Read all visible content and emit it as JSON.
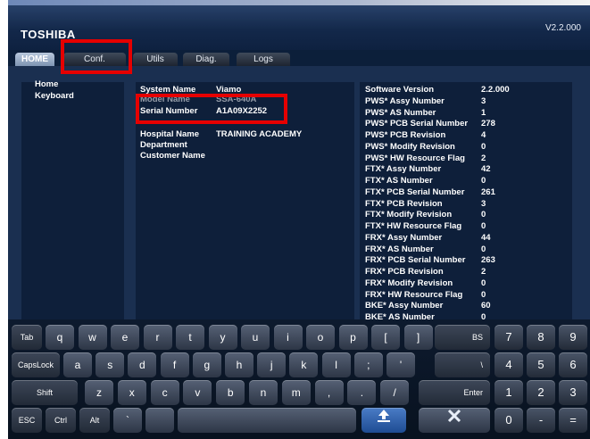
{
  "header": {
    "brand": "TOSHIBA",
    "version": "V2.2.000"
  },
  "tabs": [
    {
      "label": "HOME"
    },
    {
      "label": "Conf."
    },
    {
      "label": "Utils"
    },
    {
      "label": "Diag."
    },
    {
      "label": "Logs"
    }
  ],
  "sidebar": {
    "items": [
      {
        "label": "Home"
      },
      {
        "label": "Keyboard"
      }
    ]
  },
  "system_info": {
    "system_name": {
      "label": "System Name",
      "value": "Viamo"
    },
    "model_name": {
      "label": "Model Name",
      "value": "SSA-640A"
    },
    "serial_number": {
      "label": "Serial Number",
      "value": "A1A09X2252"
    },
    "hospital_name": {
      "label": "Hospital Name",
      "value": "TRAINING ACADEMY"
    },
    "department": {
      "label": "Department",
      "value": ""
    },
    "customer_name": {
      "label": "Customer Name",
      "value": ""
    }
  },
  "versions": [
    {
      "label": "Software Version",
      "value": "2.2.000"
    },
    {
      "label": "PWS* Assy Number",
      "value": "3"
    },
    {
      "label": "PWS* AS Number",
      "value": "1"
    },
    {
      "label": "PWS* PCB Serial Number",
      "value": "278"
    },
    {
      "label": "PWS* PCB Revision",
      "value": "4"
    },
    {
      "label": "PWS* Modify Revision",
      "value": "0"
    },
    {
      "label": "PWS* HW Resource Flag",
      "value": "2"
    },
    {
      "label": "FTX* Assy Number",
      "value": "42"
    },
    {
      "label": "FTX* AS Number",
      "value": "0"
    },
    {
      "label": "FTX* PCB Serial Number",
      "value": "261"
    },
    {
      "label": "FTX* PCB Revision",
      "value": "3"
    },
    {
      "label": "FTX* Modify Revision",
      "value": "0"
    },
    {
      "label": "FTX* HW Resource Flag",
      "value": "0"
    },
    {
      "label": "FRX* Assy Number",
      "value": "44"
    },
    {
      "label": "FRX* AS Number",
      "value": "0"
    },
    {
      "label": "FRX* PCB Serial Number",
      "value": "263"
    },
    {
      "label": "FRX* PCB Revision",
      "value": "2"
    },
    {
      "label": "FRX* Modify Revision",
      "value": "0"
    },
    {
      "label": "FRX* HW Resource Flag",
      "value": "0"
    },
    {
      "label": "BKE* Assy Number",
      "value": "60"
    },
    {
      "label": "BKE* AS Number",
      "value": "0"
    }
  ],
  "keyboard": {
    "row1": [
      "Tab",
      "q",
      "w",
      "e",
      "r",
      "t",
      "y",
      "u",
      "i",
      "o",
      "p",
      "[",
      "]",
      "BS",
      "7",
      "8",
      "9"
    ],
    "row2": [
      "CapsLock",
      "a",
      "s",
      "d",
      "f",
      "g",
      "h",
      "j",
      "k",
      "l",
      ";",
      "'",
      "\\",
      "4",
      "5",
      "6"
    ],
    "row3": [
      "Shift",
      "z",
      "x",
      "c",
      "v",
      "b",
      "n",
      "m",
      ",",
      ".",
      "/",
      "Enter",
      "1",
      "2",
      "3"
    ],
    "row4": [
      "ESC",
      "Ctrl",
      "Alt",
      "`",
      "",
      "",
      "",
      "0",
      "-",
      "="
    ]
  },
  "colors": {
    "background": "#0b1e37",
    "panel": "#0e1f3a",
    "highlight": "#e60000",
    "active_tab": "#9aaecb"
  }
}
